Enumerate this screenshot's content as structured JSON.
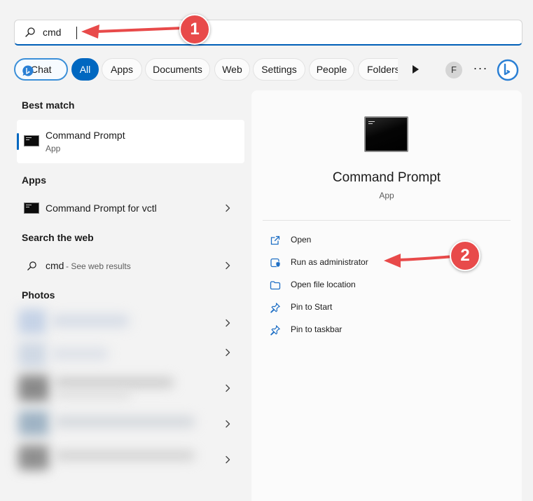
{
  "search": {
    "query": "cmd"
  },
  "filters": {
    "chat": "Chat",
    "all": "All",
    "apps": "Apps",
    "documents": "Documents",
    "web": "Web",
    "settings": "Settings",
    "people": "People",
    "folders": "Folders",
    "account_initial": "F",
    "more": "···"
  },
  "results": {
    "best_match": {
      "heading": "Best match",
      "title": "Command Prompt",
      "subtitle": "App"
    },
    "apps": {
      "heading": "Apps",
      "items": [
        {
          "title": "Command Prompt for vctl"
        }
      ]
    },
    "web": {
      "heading": "Search the web",
      "query": "cmd",
      "suffix": " - See web results"
    },
    "photos": {
      "heading": "Photos"
    }
  },
  "detail": {
    "title": "Command Prompt",
    "subtitle": "App",
    "actions": [
      {
        "label": "Open",
        "icon": "open-external-icon"
      },
      {
        "label": "Run as administrator",
        "icon": "shield-window-icon"
      },
      {
        "label": "Open file location",
        "icon": "folder-icon"
      },
      {
        "label": "Pin to Start",
        "icon": "pin-icon"
      },
      {
        "label": "Pin to taskbar",
        "icon": "pin-icon"
      }
    ]
  },
  "annotations": [
    {
      "number": "1"
    },
    {
      "number": "2"
    }
  ],
  "colors": {
    "accent": "#0067c0",
    "annotation": "#e84a4a",
    "background": "#f3f3f3"
  }
}
